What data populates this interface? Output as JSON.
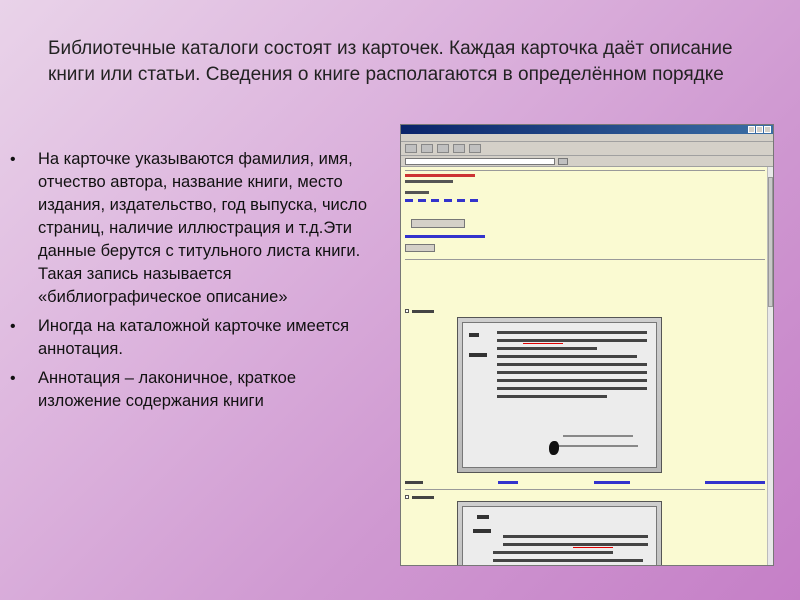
{
  "title": "Библиотечные каталоги состоят из карточек. Каждая карточка даёт описание книги или статьи. Сведения о книге располагаются в определённом порядке",
  "bullets": [
    "На карточке указываются фамилия, имя, отчество автора, название книги, место издания, издательство, год выпуска, число страниц, наличие иллюстрация и т.д.Эти данные берутся с титульного листа книги. Такая запись называется «библиографическое описание»",
    "Иногда на каталожной карточке имеется аннотация.",
    "Аннотация – лаконичное, краткое изложение содержания книги"
  ],
  "colors": {
    "background_light": "#e9d3e9",
    "background_dark": "#c57fc7",
    "screenshot_bg": "#fafad2"
  },
  "icons": {
    "bullet": "bullet-dot-icon"
  }
}
